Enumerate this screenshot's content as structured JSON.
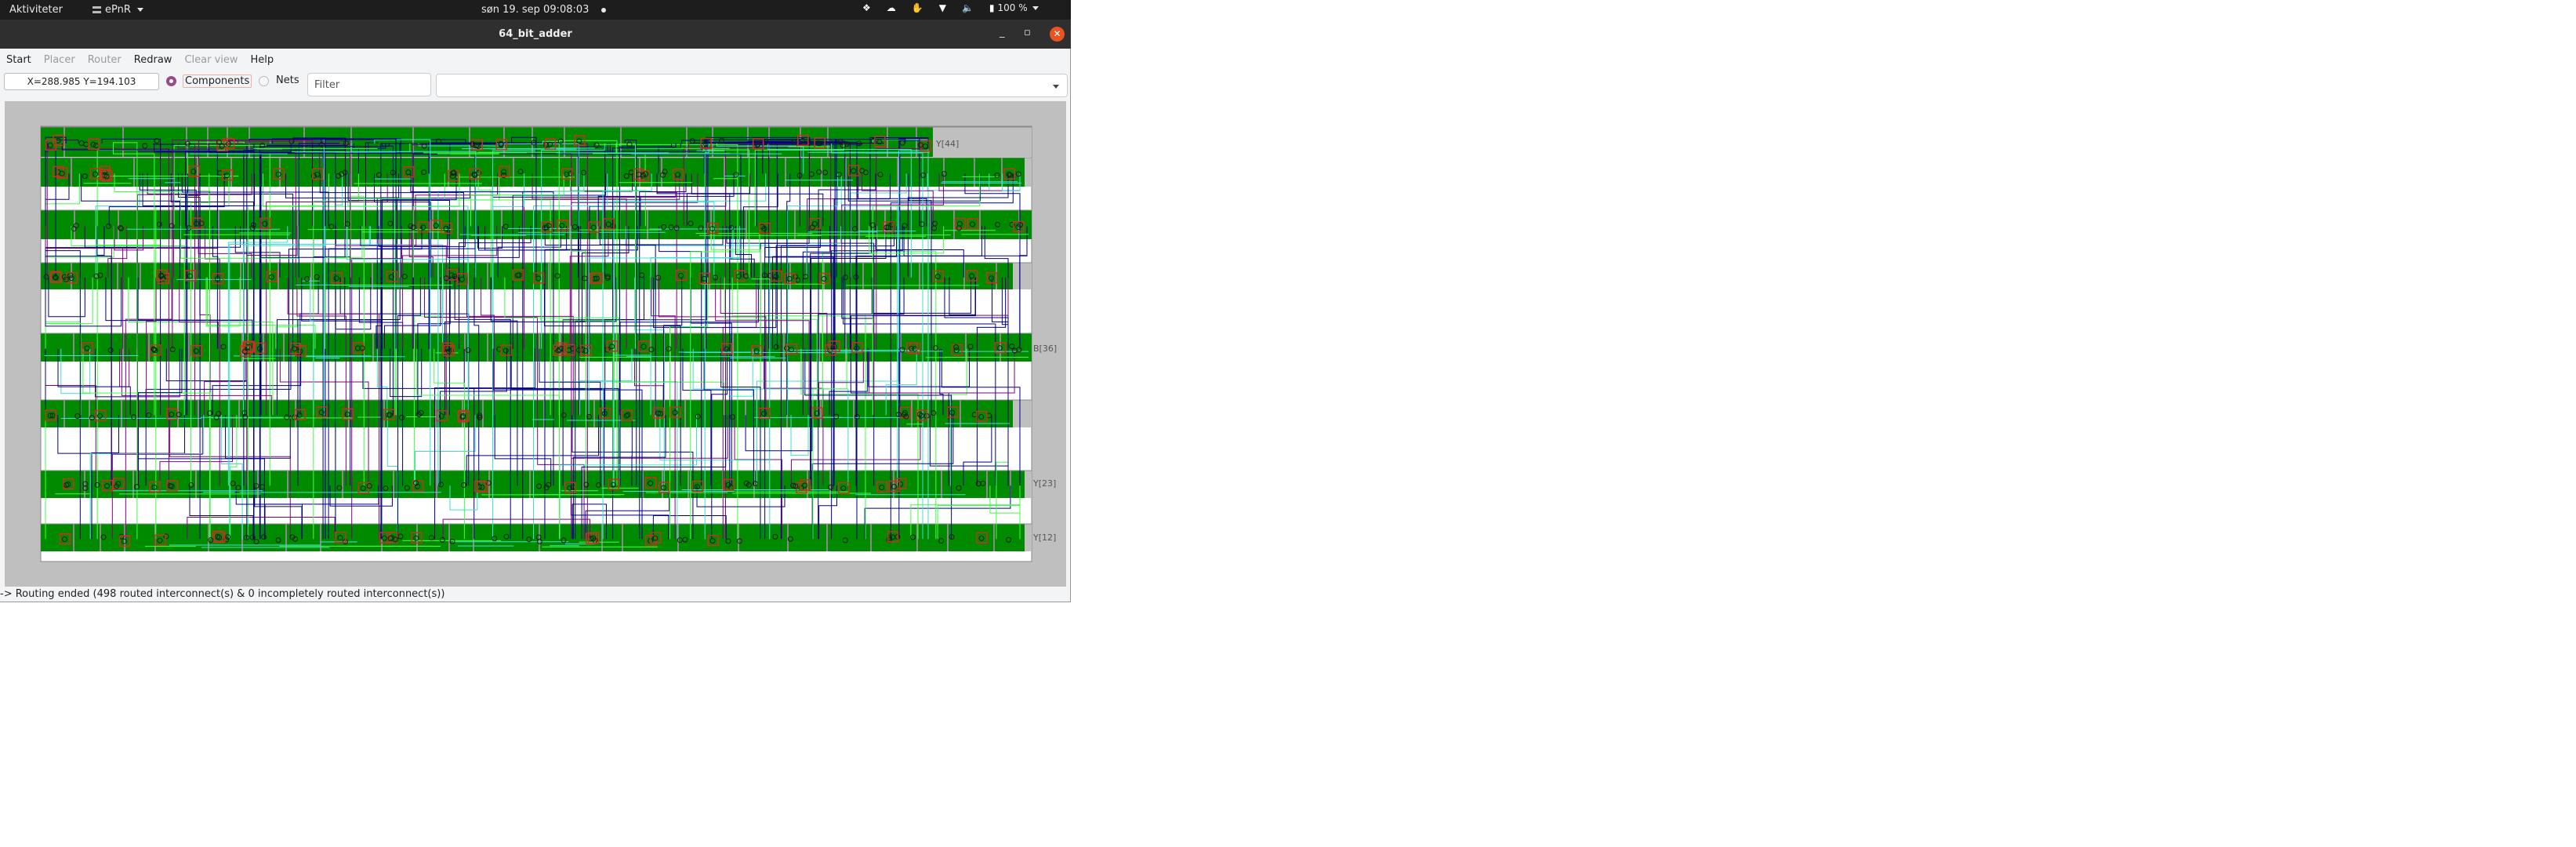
{
  "topbar": {
    "activities": "Aktiviteter",
    "app_name": "ePnR",
    "clock": "søn 19. sep  09:08:03",
    "battery": "100 %"
  },
  "window": {
    "title": "64_bit_adder",
    "minimize": "_",
    "maximize": "▫",
    "close": "✕"
  },
  "menu": {
    "items": [
      {
        "label": "Start",
        "enabled": true
      },
      {
        "label": "Placer",
        "enabled": false
      },
      {
        "label": "Router",
        "enabled": false
      },
      {
        "label": "Redraw",
        "enabled": true
      },
      {
        "label": "Clear view",
        "enabled": false
      },
      {
        "label": "Help",
        "enabled": true
      }
    ]
  },
  "toolbar": {
    "coordinates": "X=288.985 Y=194.103",
    "radio_components": "Components",
    "radio_nets": "Nets",
    "selected_mode": "Components",
    "filter_placeholder": "Filter",
    "combo_value": ""
  },
  "layout": {
    "pin_labels": [
      "Y[44]",
      "B[36]",
      "Y[23]",
      "Y[12]"
    ],
    "colors": {
      "cell": "#008a00",
      "cell_border": "#8a8a8a",
      "background": "#bfbfbf",
      "channel": "#ffffff",
      "metal1": "#000080",
      "metal2": "#40e0d0",
      "metal3": "#40ff40",
      "via": "#800080",
      "instance_box": "#c83020"
    }
  },
  "status": {
    "message": "-> Routing ended (498 routed interconnect(s) & 0 incompletely routed interconnect(s))",
    "routed": 498,
    "incomplete": 0
  }
}
